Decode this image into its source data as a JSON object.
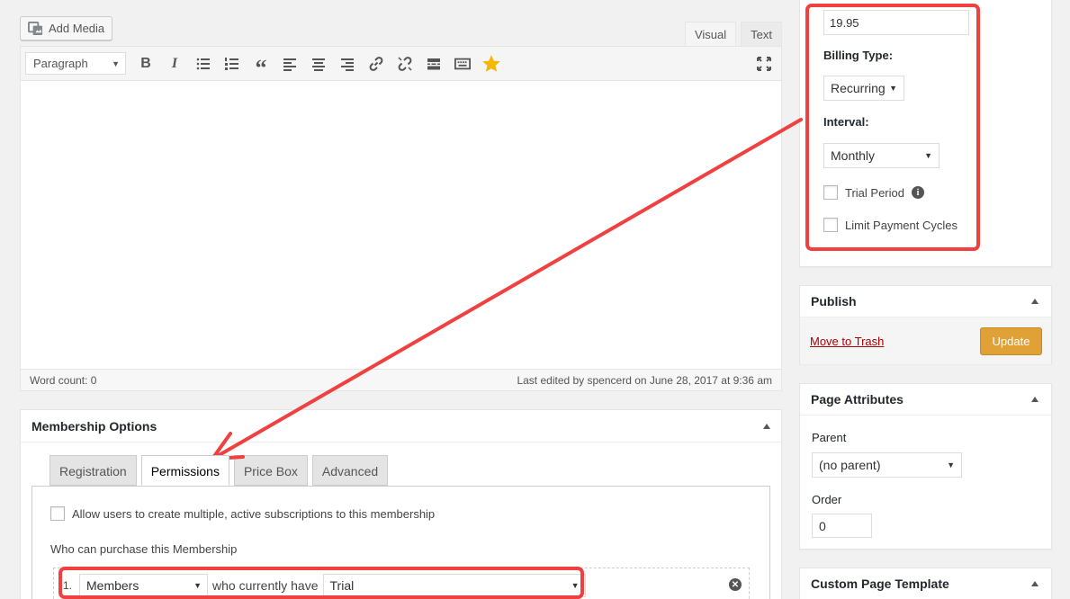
{
  "editor": {
    "add_media_label": "Add Media",
    "tabs": [
      {
        "label": "Visual"
      },
      {
        "label": "Text"
      }
    ],
    "format_select_value": "Paragraph",
    "word_count": "Word count: 0",
    "last_edited": "Last edited by spencerd on June 28, 2017 at 9:36 am"
  },
  "membership_options": {
    "title": "Membership Options",
    "tabs": [
      {
        "label": "Registration"
      },
      {
        "label": "Permissions"
      },
      {
        "label": "Price Box"
      },
      {
        "label": "Advanced"
      }
    ],
    "allow_multiple_label": "Allow users to create multiple, active subscriptions to this membership",
    "who_can_purchase_label": "Who can purchase this Membership",
    "rule": {
      "number": "1.",
      "user_type": "Members",
      "connector": "who currently have",
      "status": "Trial"
    }
  },
  "price_box": {
    "price_value": "19.95",
    "billing_type_label": "Billing Type:",
    "billing_type_value": "Recurring",
    "interval_label": "Interval:",
    "interval_value": "Monthly",
    "trial_period_label": "Trial Period",
    "limit_cycles_label": "Limit Payment Cycles"
  },
  "publish": {
    "title": "Publish",
    "move_to_trash": "Move to Trash",
    "update_label": "Update"
  },
  "page_attributes": {
    "title": "Page Attributes",
    "parent_label": "Parent",
    "parent_value": "(no parent)",
    "order_label": "Order",
    "order_value": "0"
  },
  "custom_template": {
    "title": "Custom Page Template"
  },
  "colors": {
    "annotation_red": "#f04040",
    "update_button": "#e0a136",
    "trash_link": "#a00000",
    "star": "#f5b800"
  }
}
